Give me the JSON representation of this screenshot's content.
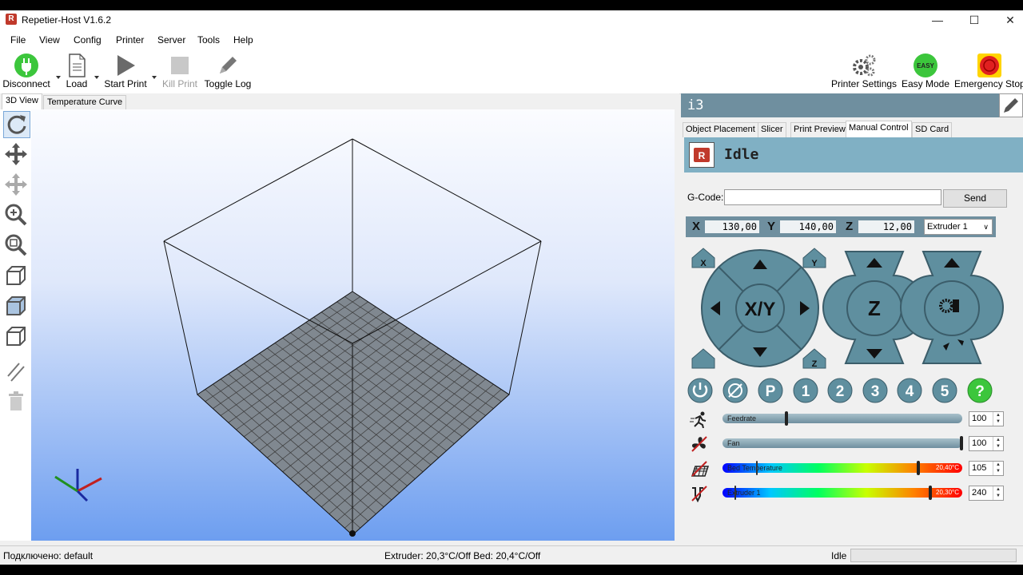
{
  "window": {
    "title": "Repetier-Host V1.6.2"
  },
  "menu": [
    "File",
    "View",
    "Config",
    "Printer",
    "Server",
    "Tools",
    "Help"
  ],
  "toolbar": {
    "disconnect": "Disconnect",
    "load": "Load",
    "start_print": "Start Print",
    "kill_print": "Kill Print",
    "toggle_log": "Toggle Log",
    "printer_settings": "Printer Settings",
    "easy_mode": "Easy Mode",
    "easy_badge": "EASY",
    "emergency_stop": "Emergency Stop"
  },
  "view_tabs": [
    "3D View",
    "Temperature Curve"
  ],
  "printer": {
    "name": "i3"
  },
  "right_tabs": [
    "Object Placement",
    "Slicer",
    "Print Preview",
    "Manual Control",
    "SD Card"
  ],
  "status": {
    "text": "Idle"
  },
  "gcode": {
    "label": "G-Code:",
    "value": "",
    "send": "Send"
  },
  "coords": {
    "x_label": "X",
    "x": "130,00",
    "y_label": "Y",
    "y": "140,00",
    "z_label": "Z",
    "z": "12,00",
    "extruder": "Extruder 1"
  },
  "jog": {
    "xy": "X/Y",
    "z": "Z",
    "home_x": "X",
    "home_y": "Y",
    "home_z": "Z",
    "home_z2": "Z"
  },
  "buttons": [
    "P",
    "1",
    "2",
    "3",
    "4",
    "5",
    "?"
  ],
  "sliders": {
    "feedrate": {
      "label": "Feedrate",
      "value": "100",
      "level": 0.27
    },
    "fan": {
      "label": "Fan",
      "value": "100",
      "level": 1.0
    },
    "bed": {
      "label": "Bed Temperature",
      "temp": "20,40°C",
      "value": "105",
      "level": 0.82
    },
    "extruder": {
      "label": "Extruder 1",
      "temp": "20,30°C",
      "value": "240",
      "level": 0.87
    }
  },
  "statusbar": {
    "connection": "Подключено: default",
    "temps": "Extruder: 20,3°C/Off Bed: 20,4°C/Off",
    "state": "Idle"
  },
  "colors": {
    "panel_header": "#6f8f9f",
    "status_bg": "#80b0c4",
    "button_teal": "#5f8f9f",
    "green": "#3cc63c",
    "red": "#e02020"
  }
}
